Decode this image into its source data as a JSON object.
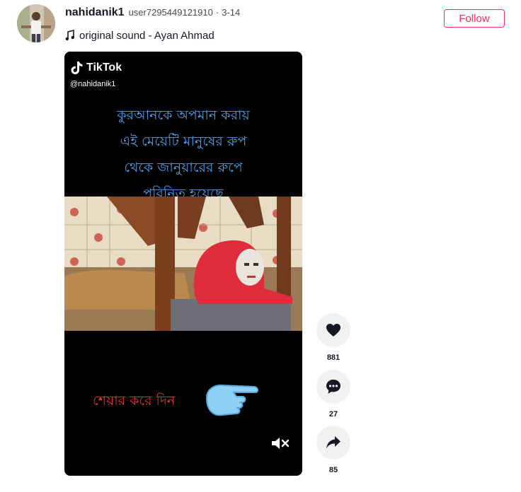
{
  "author": {
    "name": "nahidanik1",
    "id": "user7295449121910",
    "separator": "·",
    "date": "3-14"
  },
  "music": {
    "icon": "music-note-icon",
    "title": "original sound - Ayan Ahmad"
  },
  "follow_label": "Follow",
  "video": {
    "watermark_brand": "TikTok",
    "watermark_handle": "@nahidanik1",
    "caption_lines": [
      "কুরআনকে অপমান করায়",
      "এই মেয়েটি মানুষের রুপ",
      "থেকে জানুয়ারের রুপে",
      "পরিনিত হয়েছে"
    ],
    "share_text": "শেয়ার করে দিন",
    "caption_color": "#4a9fe6",
    "share_text_color": "#e0342a"
  },
  "actions": {
    "like": {
      "icon": "heart-icon",
      "count": "881"
    },
    "comment": {
      "icon": "comment-icon",
      "count": "27"
    },
    "share": {
      "icon": "share-arrow-icon",
      "count": "85"
    }
  },
  "colors": {
    "accent": "#fe2c55",
    "text": "#161823"
  }
}
